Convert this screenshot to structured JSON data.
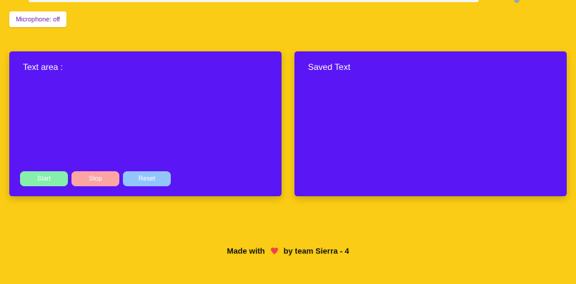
{
  "app": {
    "microphone_status": "Microphone: off"
  },
  "text_panel": {
    "title": "Text area :",
    "buttons": {
      "start": "Start",
      "stop": "Stop",
      "reset": "Reset"
    }
  },
  "saved_panel": {
    "title": "Saved Text"
  },
  "footer": {
    "prefix": "Made with",
    "suffix": "by team Sierra - 4",
    "icon": "heart-icon"
  },
  "colors": {
    "background": "#facc15",
    "panel": "#5b16f5",
    "start": "#86efac",
    "stop": "#fca5a5",
    "reset": "#93c5fd",
    "heart": "#ef4444"
  }
}
